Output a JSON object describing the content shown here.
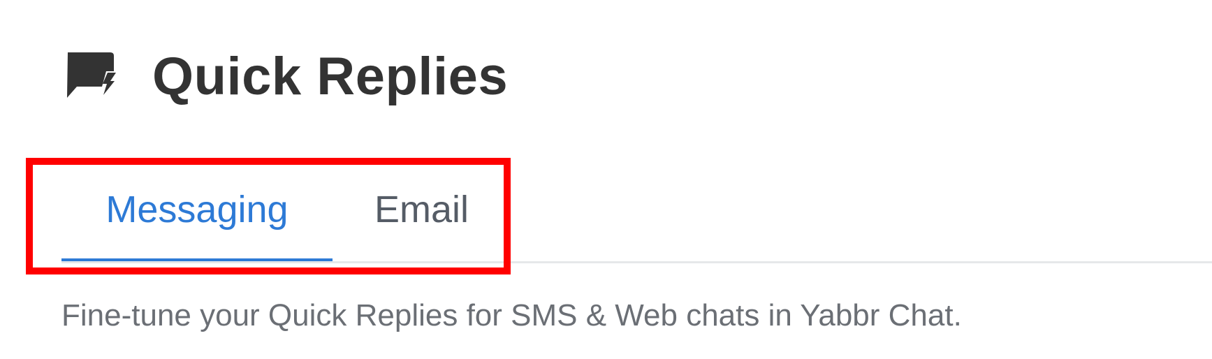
{
  "header": {
    "icon": "quick-reply-chat-bolt-icon",
    "title": "Quick Replies"
  },
  "tabs": [
    {
      "label": "Messaging",
      "active": true
    },
    {
      "label": "Email",
      "active": false
    }
  ],
  "description": "Fine-tune your Quick Replies for SMS & Web chats in Yabbr Chat.",
  "colors": {
    "accent": "#2d7ad6",
    "title_text": "#333333",
    "inactive_tab": "#555c66",
    "description_text": "#6b6f75",
    "highlight": "#ff0000",
    "divider": "#e6e8ea"
  }
}
